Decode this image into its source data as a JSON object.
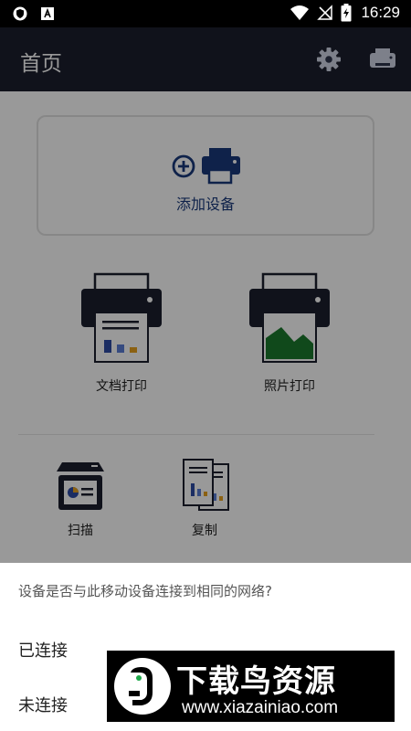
{
  "status_bar": {
    "time": "16:29",
    "left_icons": [
      "shield-app-icon",
      "a-app-icon"
    ],
    "right_icons": [
      "wifi-icon",
      "no-signal-icon",
      "battery-charging-icon"
    ]
  },
  "app_bar": {
    "title": "首页",
    "actions": [
      "gear-icon",
      "printer-icon"
    ]
  },
  "add_device": {
    "label": "添加设备",
    "icons": [
      "plus-circle-icon",
      "printer-icon"
    ]
  },
  "tiles": [
    {
      "label": "文档打印",
      "icon": "document-print-icon"
    },
    {
      "label": "照片打印",
      "icon": "photo-print-icon"
    },
    {
      "label": "扫描",
      "icon": "scan-icon"
    },
    {
      "label": "复制",
      "icon": "copy-icon"
    }
  ],
  "dialog": {
    "question": "设备是否与此移动设备连接到相同的网络?",
    "options": [
      "已连接",
      "未连接"
    ]
  },
  "watermark": {
    "name": "下载鸟资源",
    "url": "www.xiazainiao.com"
  },
  "colors": {
    "app_bar": "#1b1f2d",
    "accent": "#1a3a7c",
    "printer_body": "#1b1f2d",
    "overlay": "rgba(0,0,0,0.40)"
  }
}
